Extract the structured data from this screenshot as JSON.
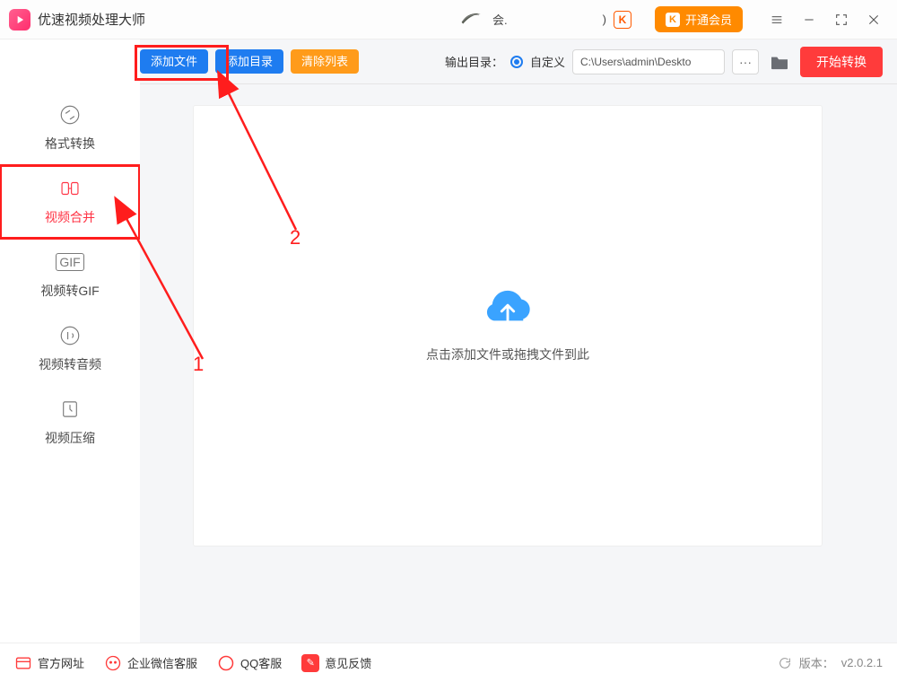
{
  "titlebar": {
    "app_name": "优速视频处理大师",
    "greeting": "会.",
    "vip_button": "开通会员",
    "paren": ")"
  },
  "toolbar": {
    "add_file": "添加文件",
    "add_folder": "添加目录",
    "clear_list": "清除列表",
    "output_label": "输出目录：",
    "radio_custom": "自定义",
    "path_value": "C:\\Users\\admin\\Deskto",
    "start": "开始转换"
  },
  "sidebar": {
    "items": [
      {
        "label": "格式转换"
      },
      {
        "label": "视频合并"
      },
      {
        "label": "视频转GIF"
      },
      {
        "label": "视频转音频"
      },
      {
        "label": "视频压缩"
      }
    ]
  },
  "drop": {
    "hint": "点击添加文件或拖拽文件到此"
  },
  "footer": {
    "site": "官方网址",
    "wechat": "企业微信客服",
    "qq": "QQ客服",
    "feedback": "意见反馈",
    "version_label": "版本：",
    "version_value": "v2.0.2.1"
  },
  "annotation": {
    "n1": "1",
    "n2": "2"
  },
  "colors": {
    "accent_red": "#ff3344",
    "accent_blue": "#1e7cf0",
    "accent_orange": "#ff8a00",
    "danger": "#ff3b3b"
  }
}
